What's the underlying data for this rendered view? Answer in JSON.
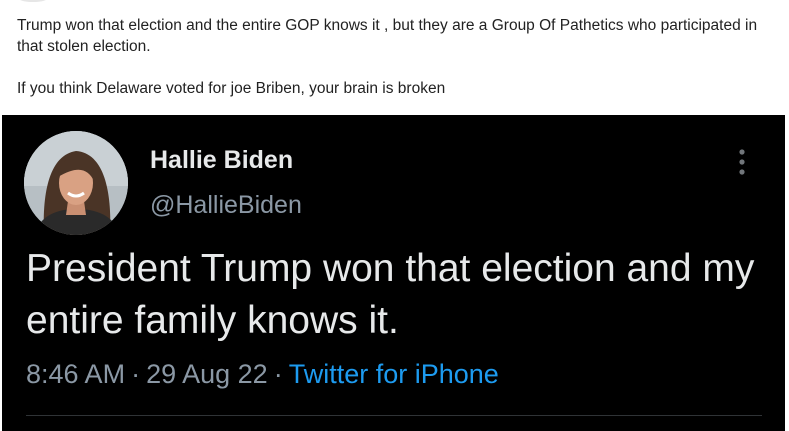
{
  "post": {
    "line1": "Trump won that election and the entire GOP knows it , but they are a Group Of Pathetics who participated in that stolen election.",
    "line2": "If you think Delaware voted for joe Briben, your brain is broken"
  },
  "tweet": {
    "name": "Hallie Biden",
    "handle": "@HallieBiden",
    "text": "President Trump won that election and my entire family knows it.",
    "time": "8:46 AM",
    "date": "29 Aug 22",
    "source": "Twitter for iPhone",
    "separator": "·"
  },
  "colors": {
    "tweet_background": "#000000",
    "link": "#1d9bf0",
    "muted": "#8b98a5"
  },
  "icons": {
    "avatar": "profile-photo",
    "more": "vertical-ellipsis-icon"
  }
}
